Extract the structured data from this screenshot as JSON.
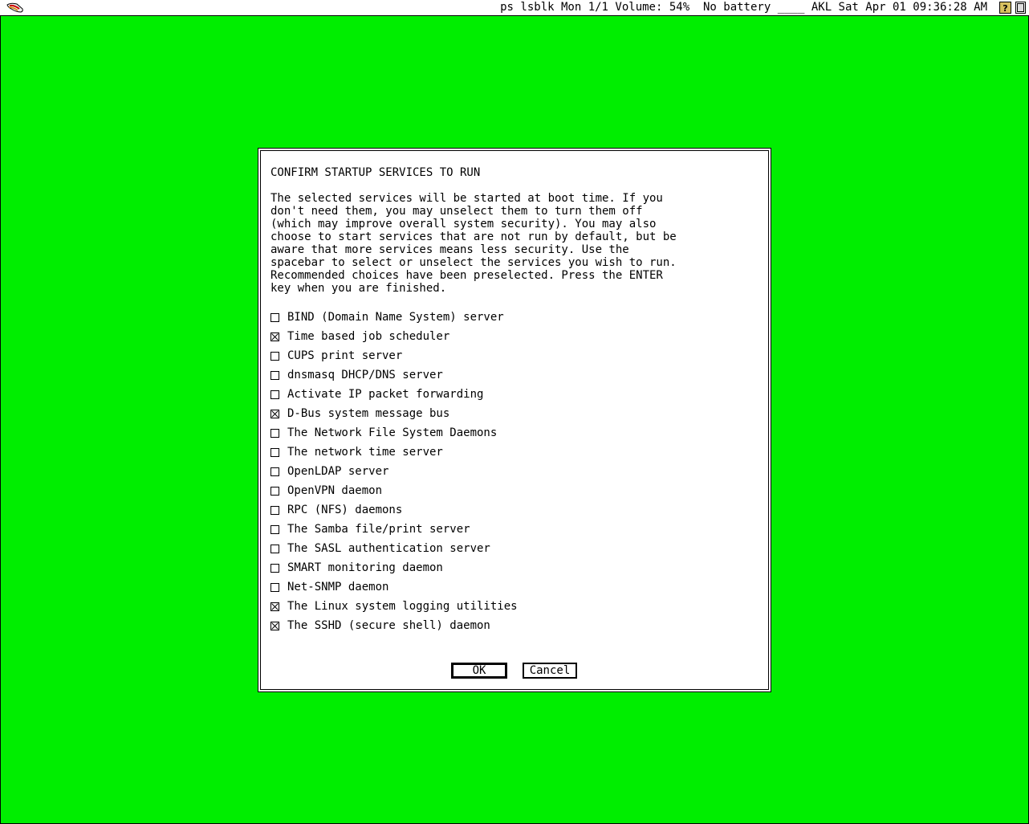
{
  "colors": {
    "desktop": "#00ee00",
    "window": "#ffffff",
    "text": "#000000"
  },
  "menubar": {
    "status": "ps lsblk Mon 1/1 Volume: 54%  No battery ____ AKL Sat Apr 01 09:36:28 AM",
    "icons": [
      "app-menu-icon",
      "help-icon",
      "window-icon"
    ]
  },
  "dialog": {
    "title": "CONFIRM STARTUP SERVICES TO RUN",
    "description": "The selected services will be started at boot time. If you\ndon't need them, you may unselect them to turn them off\n(which may improve overall system security). You may also\nchoose to start services that are not run by default, but be\naware that more services means less security. Use the\nspacebar to select or unselect the services you wish to run.\nRecommended choices have been preselected. Press the ENTER\nkey when you are finished.",
    "services": [
      {
        "label": "BIND (Domain Name System) server",
        "checked": false
      },
      {
        "label": "Time based job scheduler",
        "checked": true
      },
      {
        "label": "CUPS print server",
        "checked": false
      },
      {
        "label": "dnsmasq DHCP/DNS server",
        "checked": false
      },
      {
        "label": "Activate IP packet forwarding",
        "checked": false
      },
      {
        "label": "D-Bus system message bus",
        "checked": true
      },
      {
        "label": "The Network File System Daemons",
        "checked": false
      },
      {
        "label": "The network time server",
        "checked": false
      },
      {
        "label": "OpenLDAP server",
        "checked": false
      },
      {
        "label": "OpenVPN daemon",
        "checked": false
      },
      {
        "label": "RPC (NFS) daemons",
        "checked": false
      },
      {
        "label": "The Samba file/print server",
        "checked": false
      },
      {
        "label": "The SASL authentication server",
        "checked": false
      },
      {
        "label": "SMART monitoring daemon",
        "checked": false
      },
      {
        "label": "Net-SNMP daemon",
        "checked": false
      },
      {
        "label": "The Linux system logging utilities",
        "checked": true
      },
      {
        "label": "The SSHD (secure shell) daemon",
        "checked": true
      }
    ],
    "ok_label": "OK",
    "cancel_label": "Cancel"
  }
}
